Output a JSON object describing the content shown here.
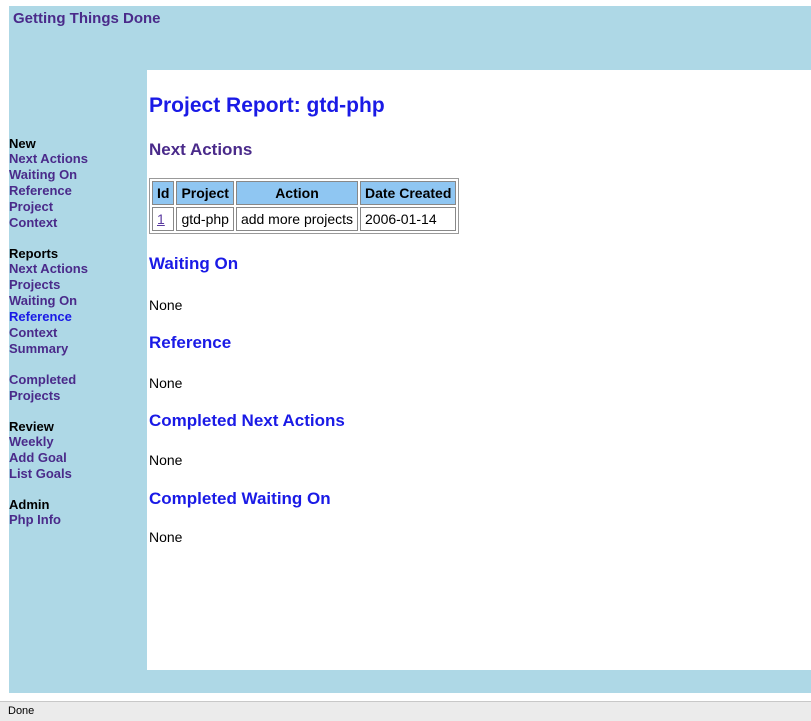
{
  "header": {
    "title": "Getting Things Done"
  },
  "sidebar": {
    "groups": [
      {
        "title": "New",
        "items": [
          {
            "label": "Next Actions"
          },
          {
            "label": "Waiting On"
          },
          {
            "label": "Reference"
          },
          {
            "label": "Project"
          },
          {
            "label": "Context"
          }
        ]
      },
      {
        "title": "Reports",
        "items": [
          {
            "label": "Next Actions"
          },
          {
            "label": "Projects"
          },
          {
            "label": "Waiting On"
          },
          {
            "label": "Reference"
          },
          {
            "label": "Context"
          },
          {
            "label": "Summary"
          }
        ]
      },
      {
        "title": "Completed",
        "items": [
          {
            "label": "Projects"
          }
        ]
      },
      {
        "title": "Review",
        "items": [
          {
            "label": "Weekly"
          },
          {
            "label": "Add Goal"
          },
          {
            "label": "List Goals"
          }
        ]
      },
      {
        "title": "Admin",
        "items": [
          {
            "label": "Php Info"
          }
        ]
      }
    ]
  },
  "main": {
    "title": "Project Report: gtd-php",
    "next_actions": {
      "heading": "Next Actions",
      "columns": [
        "Id",
        "Project",
        "Action",
        "Date Created"
      ],
      "rows": [
        {
          "id": "1",
          "project": "gtd-php",
          "action": "add more projects",
          "date": "2006-01-14"
        }
      ]
    },
    "sections": [
      {
        "heading": "Waiting On",
        "text": "None"
      },
      {
        "heading": "Reference",
        "text": "None"
      },
      {
        "heading": "Completed Next Actions",
        "text": "None"
      },
      {
        "heading": "Completed Waiting On",
        "text": "None"
      }
    ]
  },
  "status_bar": {
    "text": "Done"
  },
  "colors": {
    "frame_bg": "#aed8e6",
    "link_purple": "#4a2a8a",
    "heading_blue": "#1a1ae6",
    "table_header_bg": "#8fc6f2"
  }
}
